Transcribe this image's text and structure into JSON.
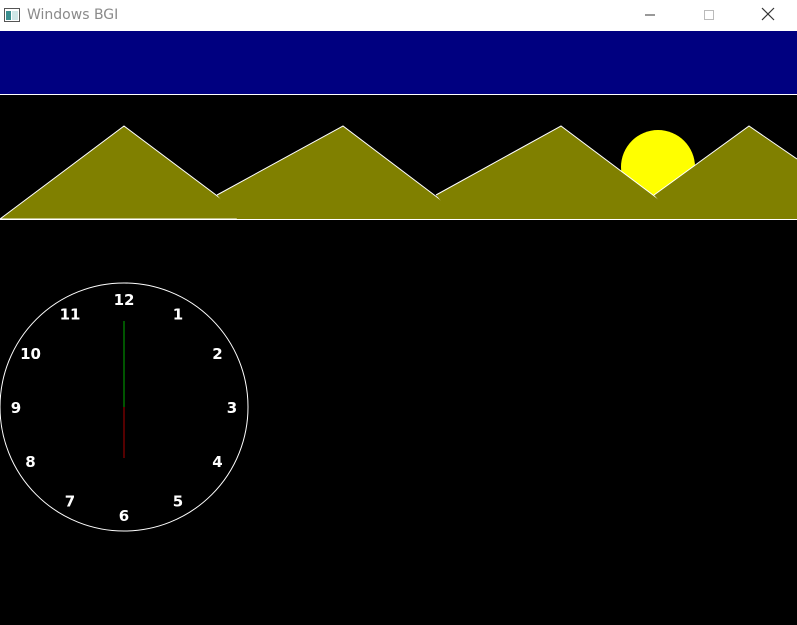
{
  "window": {
    "title": "Windows BGI",
    "buttons": {
      "minimize": "minimize-icon",
      "maximize": "maximize-icon",
      "close": "close-icon"
    }
  },
  "scene": {
    "colors": {
      "sky_band": "#000080",
      "background": "#000000",
      "mountain": "#808000",
      "mountain_outline": "#ffffff",
      "sun": "#ffff00",
      "clock_face_outline": "#ffffff",
      "clock_numbers": "#ffffff",
      "minute_hand": "#00aa00",
      "hour_hand": "#aa0000"
    },
    "clock": {
      "numbers": [
        "12",
        "1",
        "2",
        "3",
        "4",
        "5",
        "6",
        "7",
        "8",
        "9",
        "10",
        "11"
      ]
    }
  }
}
